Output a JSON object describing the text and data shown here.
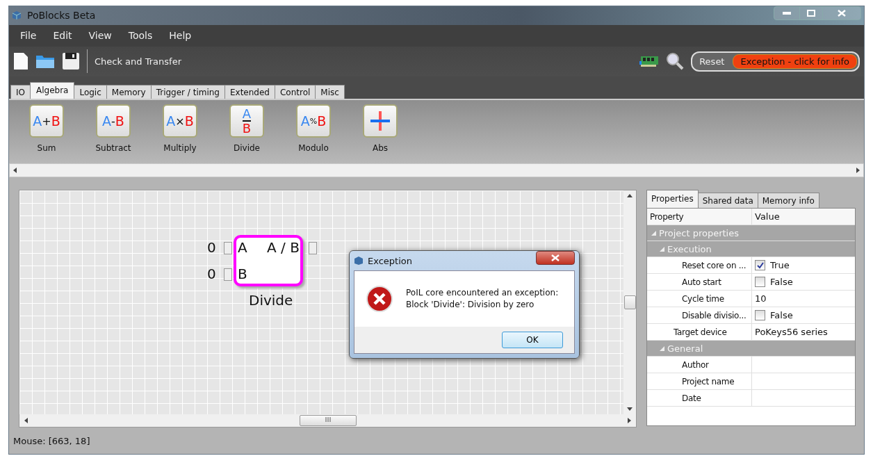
{
  "window": {
    "title": "PoBlocks Beta"
  },
  "menu": [
    "File",
    "Edit",
    "View",
    "Tools",
    "Help"
  ],
  "toolbar": {
    "check_transfer": "Check and Transfer",
    "reset": "Reset",
    "exception": "Exception - click for info"
  },
  "tabs": [
    {
      "label": "IO",
      "selected": false
    },
    {
      "label": "Algebra",
      "selected": true
    },
    {
      "label": "Logic",
      "selected": false
    },
    {
      "label": "Memory",
      "selected": false
    },
    {
      "label": "Trigger / timing",
      "selected": false
    },
    {
      "label": "Extended",
      "selected": false
    },
    {
      "label": "Control",
      "selected": false
    },
    {
      "label": "Misc",
      "selected": false
    }
  ],
  "palette": [
    {
      "kind": "inline",
      "a": "A",
      "op": "+",
      "b": "B",
      "label": "Sum"
    },
    {
      "kind": "inline",
      "a": "A",
      "op": "-",
      "b": "B",
      "label": "Subtract"
    },
    {
      "kind": "inline",
      "a": "A",
      "op": "×",
      "b": "B",
      "label": "Multiply"
    },
    {
      "kind": "fraction",
      "a": "A",
      "b": "B",
      "label": "Divide"
    },
    {
      "kind": "inline",
      "a": "A",
      "op": "%",
      "b": "B",
      "label": "Modulo"
    },
    {
      "kind": "cross",
      "label": "Abs"
    }
  ],
  "canvas": {
    "block": {
      "title": "Divide",
      "selected": true,
      "output": "A / B",
      "inputs": [
        {
          "value": "0",
          "label": "A"
        },
        {
          "value": "0",
          "label": "B"
        }
      ]
    }
  },
  "dialog": {
    "title": "Exception",
    "message": "PoIL core encountered an exception:\nBlock 'Divide': Division by zero",
    "button": "OK"
  },
  "panel": {
    "tabs": [
      {
        "label": "Properties",
        "selected": true
      },
      {
        "label": "Shared data",
        "selected": false
      },
      {
        "label": "Memory info",
        "selected": false
      }
    ],
    "columns": [
      "Property",
      "Value"
    ],
    "rows": [
      {
        "kind": "group",
        "label": "Project properties",
        "expanded": true,
        "children": [
          {
            "kind": "group",
            "label": "Execution",
            "expanded": true,
            "children": [
              {
                "kind": "check",
                "label": "Reset core on ...",
                "value": "True",
                "checked": true
              },
              {
                "kind": "check",
                "label": "Auto start",
                "value": "False",
                "checked": false
              },
              {
                "kind": "text",
                "label": "Cycle time",
                "value": "10"
              },
              {
                "kind": "check",
                "label": "Disable divisio...",
                "value": "False",
                "checked": false
              }
            ]
          },
          {
            "kind": "text",
            "label": "Target device",
            "value": "PoKeys56 series"
          },
          {
            "kind": "group",
            "label": "General",
            "expanded": true,
            "children": [
              {
                "kind": "text",
                "label": "Author"
              },
              {
                "kind": "text",
                "label": "Project name"
              },
              {
                "kind": "text",
                "label": "Date"
              }
            ]
          }
        ]
      }
    ]
  },
  "status_bar": "Mouse: [663, 18]"
}
